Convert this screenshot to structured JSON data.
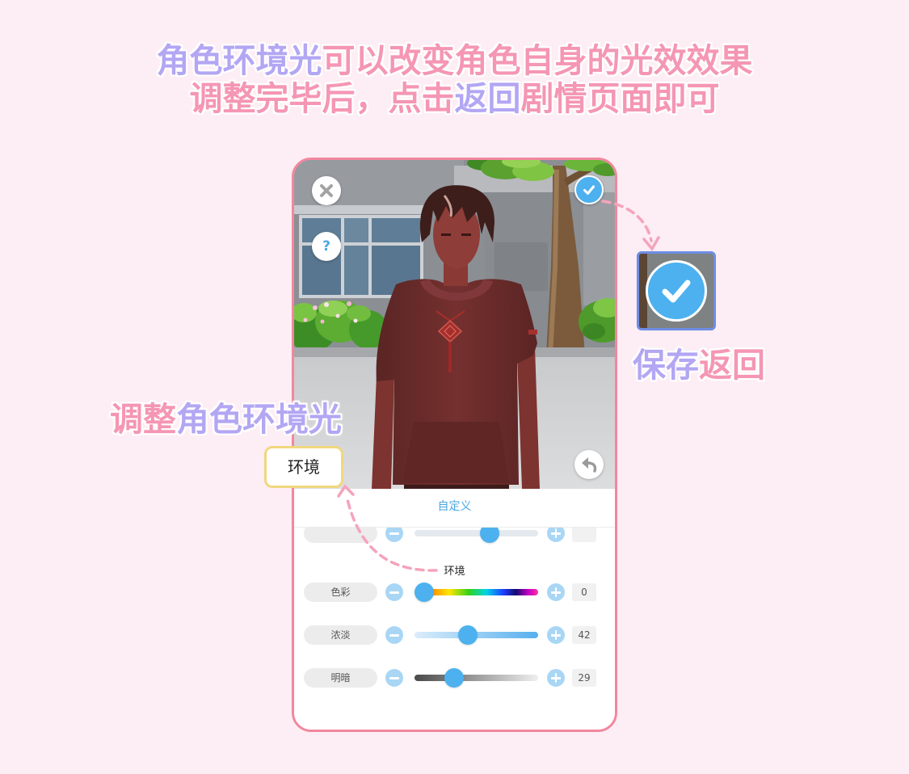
{
  "header": {
    "line1_highlight": "角色环境光",
    "line1_rest": "可以改变角色自身的光效效果",
    "line2_start": "调整完毕后，点击",
    "line2_highlight": "返回",
    "line2_end": "剧情页面即可"
  },
  "phone": {
    "scene_buttons": {
      "close": {
        "icon": "close-icon"
      },
      "help": {
        "icon": "help-icon",
        "glyph": "?"
      },
      "confirm": {
        "icon": "check-icon"
      },
      "undo": {
        "icon": "undo-icon"
      }
    },
    "panel_title": "自定义",
    "clipped_slider": {
      "level": 0.63
    },
    "section_label": "环境",
    "sliders": [
      {
        "label": "色彩",
        "value": 0
      },
      {
        "label": "浓淡",
        "value": 42
      },
      {
        "label": "明暗",
        "value": 29
      }
    ]
  },
  "annotations": {
    "save": {
      "icon": "check-icon",
      "label_a": "保存",
      "label_b": "返回"
    },
    "adjust": {
      "label_a": "调整",
      "label_b": "角色环境光"
    },
    "callout": {
      "label": "环境"
    }
  },
  "colors": {
    "background": "#fdedf4",
    "pink_text": "#f596b4",
    "purple_text": "#b3a6f3",
    "phone_frame": "#f2879f",
    "accent_blue": "#4db1ef",
    "light_blue_button": "#a9d6f5",
    "callout_border": "#f1d77f",
    "save_border": "#6e8de4",
    "arrow": "#f5a3bb"
  }
}
